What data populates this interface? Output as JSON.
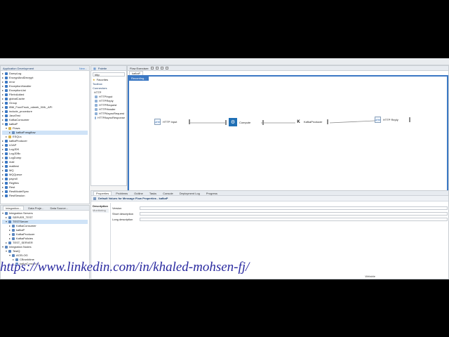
{
  "left_explorer": {
    "title": "Application Development",
    "new_label": "New...",
    "items": [
      {
        "label": "DumpLog",
        "level": 0,
        "kind": "app"
      },
      {
        "label": "EncryptAndDecrypt",
        "level": 0,
        "kind": "app"
      },
      {
        "label": "error",
        "level": 0,
        "kind": "app"
      },
      {
        "label": "ExceptionHandler",
        "level": 0,
        "kind": "app"
      },
      {
        "label": "ExceptionList",
        "level": 0,
        "kind": "app"
      },
      {
        "label": "FileInAdded",
        "level": 0,
        "kind": "app"
      },
      {
        "label": "globalCache",
        "level": 0,
        "kind": "app"
      },
      {
        "label": "Group",
        "level": 0,
        "kind": "app"
      },
      {
        "label": "IBM_FoodTruck_odweb_XML_API",
        "level": 0,
        "kind": "app"
      },
      {
        "label": "include_procedure",
        "level": 0,
        "kind": "app"
      },
      {
        "label": "JavaTest",
        "level": 0,
        "kind": "app"
      },
      {
        "label": "KafkaConsumer",
        "level": 0,
        "kind": "app"
      },
      {
        "label": "kafkaP",
        "level": 0,
        "kind": "app",
        "open": true
      },
      {
        "label": "Flows",
        "level": 1,
        "kind": "folder",
        "open": true
      },
      {
        "label": "kafkaP.msgflow",
        "level": 2,
        "kind": "flow",
        "selected": true
      },
      {
        "label": "ESQLs",
        "level": 1,
        "kind": "folder"
      },
      {
        "label": "kafkaProducer",
        "level": 0,
        "kind": "app"
      },
      {
        "label": "LDAP",
        "level": 0,
        "kind": "app"
      },
      {
        "label": "LogJDK",
        "level": 0,
        "kind": "app"
      },
      {
        "label": "LogJDBc",
        "level": 0,
        "kind": "app"
      },
      {
        "label": "LogDump",
        "level": 0,
        "kind": "app"
      },
      {
        "label": "mail",
        "level": 0,
        "kind": "app"
      },
      {
        "label": "mailtest",
        "level": 0,
        "kind": "app"
      },
      {
        "label": "MQ",
        "level": 0,
        "kind": "app"
      },
      {
        "label": "MQQueue",
        "level": 0,
        "kind": "app"
      },
      {
        "label": "payroll",
        "level": 0,
        "kind": "app"
      },
      {
        "label": "Regftes",
        "level": 0,
        "kind": "app"
      },
      {
        "label": "Rest",
        "level": 0,
        "kind": "app"
      },
      {
        "label": "RestModelSync",
        "level": 0,
        "kind": "app"
      },
      {
        "label": "RestSession",
        "level": 0,
        "kind": "app"
      }
    ]
  },
  "integration_explorer": {
    "tabs": [
      "Integration...",
      "Data Proje...",
      "Data Source..."
    ],
    "items": [
      {
        "label": "Integration Servers",
        "level": 0,
        "open": true
      },
      {
        "label": "SERVER_TEST",
        "level": 1
      },
      {
        "label": "TESTServer",
        "level": 1,
        "open": true,
        "selected": true
      },
      {
        "label": "KafkaConsumer",
        "level": 2
      },
      {
        "label": "kafkaP",
        "level": 2
      },
      {
        "label": "KafkaProducer",
        "level": 2
      },
      {
        "label": "KafkaPolicies",
        "level": 2
      },
      {
        "label": "TEST_SERVER",
        "level": 1
      },
      {
        "label": "Integration Nodes",
        "level": 0,
        "open": true
      },
      {
        "label": "TestQ",
        "level": 1,
        "open": true
      },
      {
        "label": "ACELOG",
        "level": 2,
        "open": true
      },
      {
        "label": "CBrunktime",
        "level": 3
      },
      {
        "label": "kafkaConsumer",
        "level": 3
      }
    ]
  },
  "palette": {
    "title": "Palette",
    "search_value": "http",
    "sections": [
      "Favorites",
      "Toolbox",
      "Connectors"
    ],
    "group": "HTTP",
    "nodes": [
      "HTTPInput",
      "HTTPReply",
      "HTTPRequest",
      "HTTPHeader",
      "HTTPAsyncRequest",
      "HTTPAsyncResponse"
    ]
  },
  "editor": {
    "tab_label": "kafkaP",
    "toolbar_label": "Flow Exerciser:",
    "status_chip": "Recording...",
    "nodes": [
      {
        "label": "HTTP Input",
        "icon": "HTTP"
      },
      {
        "label": "Compute",
        "icon": "⚙"
      },
      {
        "label": "KafkaProducer",
        "icon": "K"
      },
      {
        "label": "HTTP Reply",
        "icon": "HTTP"
      }
    ],
    "bottom_tabs": [
      "Graph",
      "User Defined Properties"
    ]
  },
  "properties": {
    "tabs": [
      "Properties",
      "Problems",
      "Outline",
      "Tasks",
      "Console",
      "Deployment Log",
      "Progress"
    ],
    "heading": "Default Values for Message Flow Properties - kafkaP",
    "side_tabs": [
      "Description",
      "Monitoring"
    ],
    "fields": [
      {
        "label": "Version",
        "value": ""
      },
      {
        "label": "Short description",
        "value": ""
      },
      {
        "label": "Long description",
        "value": ""
      }
    ]
  },
  "status_bar": {
    "writable": "Writable"
  },
  "watermark": "https://www.linkedin.com/in/khaled-mohsen-fj/",
  "colors": {
    "accent": "#3b78c4",
    "selection": "#cfe3f7",
    "compute_icon": "#1f6fb5"
  }
}
